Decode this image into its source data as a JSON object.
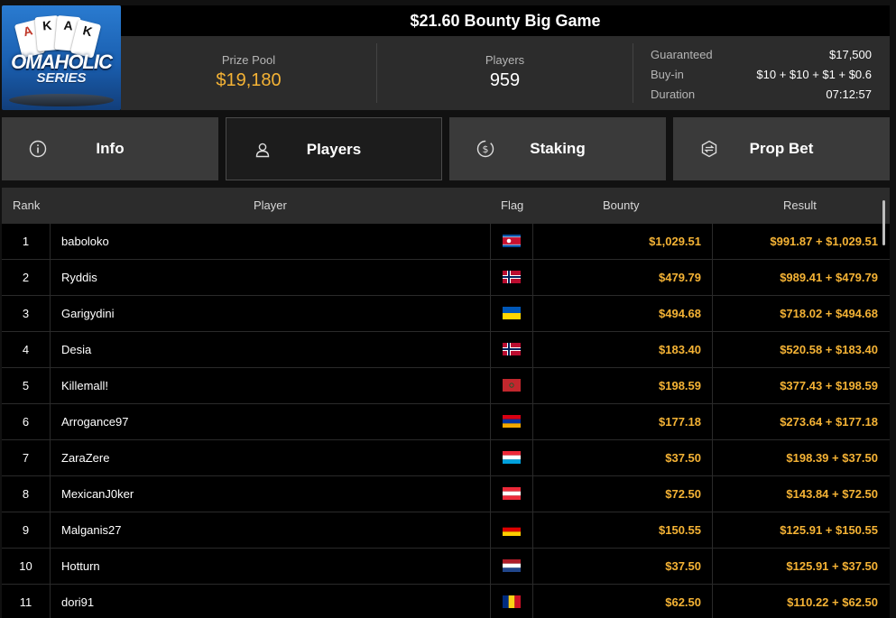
{
  "logo": {
    "cards": [
      "A",
      "K",
      "A",
      "K"
    ],
    "wordmark": "OMAHOLIC",
    "series": "SERIES"
  },
  "title": "$21.60 Bounty Big Game",
  "stats": {
    "prize_pool_label": "Prize Pool",
    "prize_pool_value": "$19,180",
    "players_label": "Players",
    "players_value": "959",
    "guaranteed_label": "Guaranteed",
    "guaranteed_value": "$17,500",
    "buyin_label": "Buy-in",
    "buyin_value": "$10 + $10 + $1 + $0.6",
    "duration_label": "Duration",
    "duration_value": "07:12:57"
  },
  "tabs": [
    {
      "label": "Info",
      "icon": "info-icon",
      "active": false
    },
    {
      "label": "Players",
      "icon": "user-icon",
      "active": true
    },
    {
      "label": "Staking",
      "icon": "staking-icon",
      "active": false
    },
    {
      "label": "Prop Bet",
      "icon": "prop-bet-icon",
      "active": false
    }
  ],
  "table": {
    "headers": {
      "rank": "Rank",
      "player": "Player",
      "flag": "Flag",
      "bounty": "Bounty",
      "result": "Result"
    },
    "rows": [
      {
        "rank": "1",
        "player": "baboloko",
        "flag": "north-korea",
        "bounty": "$1,029.51",
        "result": "$991.87 + $1,029.51"
      },
      {
        "rank": "2",
        "player": "Ryddis",
        "flag": "norway",
        "bounty": "$479.79",
        "result": "$989.41 + $479.79"
      },
      {
        "rank": "3",
        "player": "Garigydini",
        "flag": "ukraine",
        "bounty": "$494.68",
        "result": "$718.02 + $494.68"
      },
      {
        "rank": "4",
        "player": "Desia",
        "flag": "norway",
        "bounty": "$183.40",
        "result": "$520.58 + $183.40"
      },
      {
        "rank": "5",
        "player": "Killemall!",
        "flag": "morocco",
        "bounty": "$198.59",
        "result": "$377.43 + $198.59"
      },
      {
        "rank": "6",
        "player": "Arrogance97",
        "flag": "armenia",
        "bounty": "$177.18",
        "result": "$273.64 + $177.18"
      },
      {
        "rank": "7",
        "player": "ZaraZere",
        "flag": "luxembourg",
        "bounty": "$37.50",
        "result": "$198.39 + $37.50"
      },
      {
        "rank": "8",
        "player": "MexicanJ0ker",
        "flag": "austria",
        "bounty": "$72.50",
        "result": "$143.84 + $72.50"
      },
      {
        "rank": "9",
        "player": "Malganis27",
        "flag": "germany",
        "bounty": "$150.55",
        "result": "$125.91 + $150.55"
      },
      {
        "rank": "10",
        "player": "Hotturn",
        "flag": "netherlands",
        "bounty": "$37.50",
        "result": "$125.91 + $37.50"
      },
      {
        "rank": "11",
        "player": "dori91",
        "flag": "romania",
        "bounty": "$62.50",
        "result": "$110.22 + $62.50"
      }
    ]
  },
  "colors": {
    "accent": "#f5b335",
    "panel": "#2c2c2c",
    "tab": "#3a3a3a",
    "background": "#000000"
  }
}
